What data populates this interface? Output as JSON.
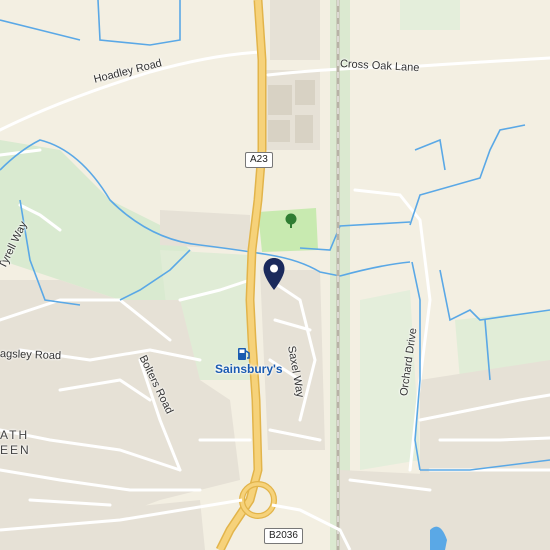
{
  "roads": {
    "hadley": "Hoadley Road",
    "cross_oak": "Cross Oak Lane",
    "tyrell": "Tyrell Way",
    "sagsley": "agsley Road",
    "bolters": "Bolters Road",
    "saxel": "Saxel Way",
    "orchard": "Orchard Drive"
  },
  "area_label_line1": "ATH",
  "area_label_line2": "EEN",
  "shields": {
    "a23": "A23",
    "b2036": "B2036"
  },
  "poi": {
    "name": "Sainsbury's",
    "icon": "fuel-pump-icon"
  },
  "markers": {
    "pin_icon": "map-pin-icon",
    "park_icon": "tree-icon"
  },
  "colors": {
    "land": "#f3efe2",
    "green": "#d9ead0",
    "park": "#c8eab0",
    "water": "#5aa8e6",
    "road_major": "#f6d27a",
    "road_major_edge": "#e2b44a",
    "residential": "#e6e1d6",
    "pin": "#1b2a5c",
    "poi": "#1a5bb0"
  }
}
